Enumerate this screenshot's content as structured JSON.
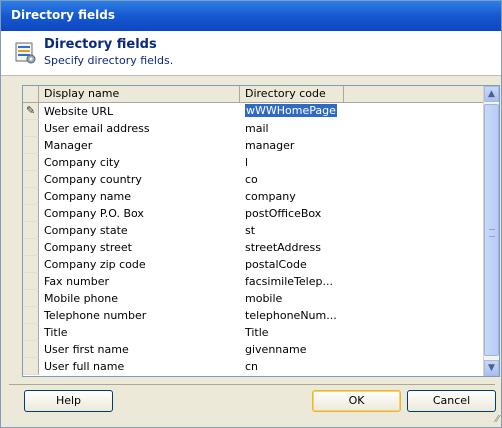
{
  "window": {
    "title": "Directory fields"
  },
  "header": {
    "title": "Directory fields",
    "subtitle": "Specify directory fields."
  },
  "grid": {
    "columns": [
      "Display name",
      "Directory code"
    ],
    "rows": [
      {
        "name": "Website URL",
        "code": "wWWHomePage"
      },
      {
        "name": "User email address",
        "code": "mail"
      },
      {
        "name": "Manager",
        "code": "manager"
      },
      {
        "name": "Company city",
        "code": "l"
      },
      {
        "name": "Company country",
        "code": "co"
      },
      {
        "name": "Company name",
        "code": "company"
      },
      {
        "name": "Company P.O. Box",
        "code": "postOfficeBox"
      },
      {
        "name": "Company state",
        "code": "st"
      },
      {
        "name": "Company street",
        "code": "streetAddress"
      },
      {
        "name": "Company zip code",
        "code": "postalCode"
      },
      {
        "name": "Fax number",
        "code": "facsimileTelep..."
      },
      {
        "name": "Mobile phone",
        "code": "mobile"
      },
      {
        "name": "Telephone number",
        "code": "telephoneNum..."
      },
      {
        "name": "Title",
        "code": "Title"
      },
      {
        "name": "User first name",
        "code": "givenname"
      },
      {
        "name": "User full name",
        "code": "cn"
      }
    ]
  },
  "buttons": {
    "help": "Help",
    "ok": "OK",
    "cancel": "Cancel"
  }
}
